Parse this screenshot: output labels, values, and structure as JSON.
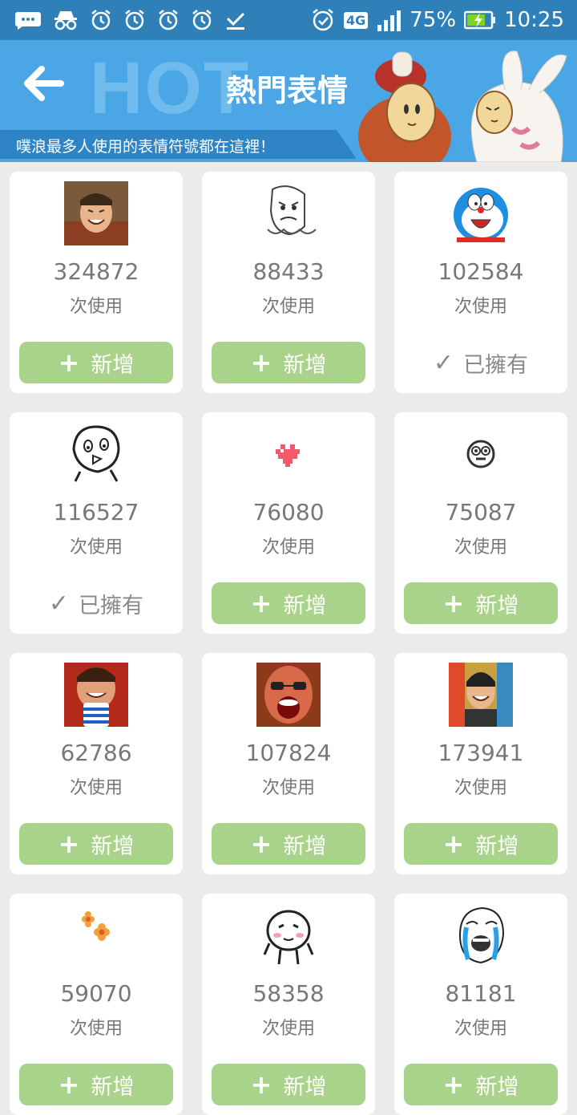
{
  "status_bar": {
    "battery": "75%",
    "time": "10:25",
    "network": "4G"
  },
  "header": {
    "hot_word": "HOT",
    "title": "熱門表情",
    "subtitle": "噗浪最多人使用的表情符號都在這裡！"
  },
  "labels": {
    "uses": "次使用",
    "add": "新增",
    "owned": "已擁有"
  },
  "emoticons": [
    {
      "count": "324872",
      "icon": "laughing-man-photo",
      "state": "add"
    },
    {
      "count": "88433",
      "icon": "rage-face-sketch",
      "state": "add"
    },
    {
      "count": "102584",
      "icon": "doraemon-shocked",
      "state": "owned"
    },
    {
      "count": "116527",
      "icon": "doodle-bird-face",
      "state": "owned"
    },
    {
      "count": "76080",
      "icon": "pixel-heart",
      "state": "add"
    },
    {
      "count": "75087",
      "icon": "small-surprised-face",
      "state": "add"
    },
    {
      "count": "62786",
      "icon": "man-holding-cup-photo",
      "state": "add"
    },
    {
      "count": "107824",
      "icon": "screaming-man-photo",
      "state": "add"
    },
    {
      "count": "173941",
      "icon": "laughing-crowd-photo",
      "state": "add"
    },
    {
      "count": "59070",
      "icon": "flowers",
      "state": "add"
    },
    {
      "count": "58358",
      "icon": "blushing-doodle",
      "state": "add"
    },
    {
      "count": "81181",
      "icon": "crying-rage-face",
      "state": "add"
    }
  ],
  "colors": {
    "status_bar": "#2f7fb8",
    "header": "#4aa6e4",
    "add_button": "#a9d28a",
    "background": "#ebebeb"
  }
}
